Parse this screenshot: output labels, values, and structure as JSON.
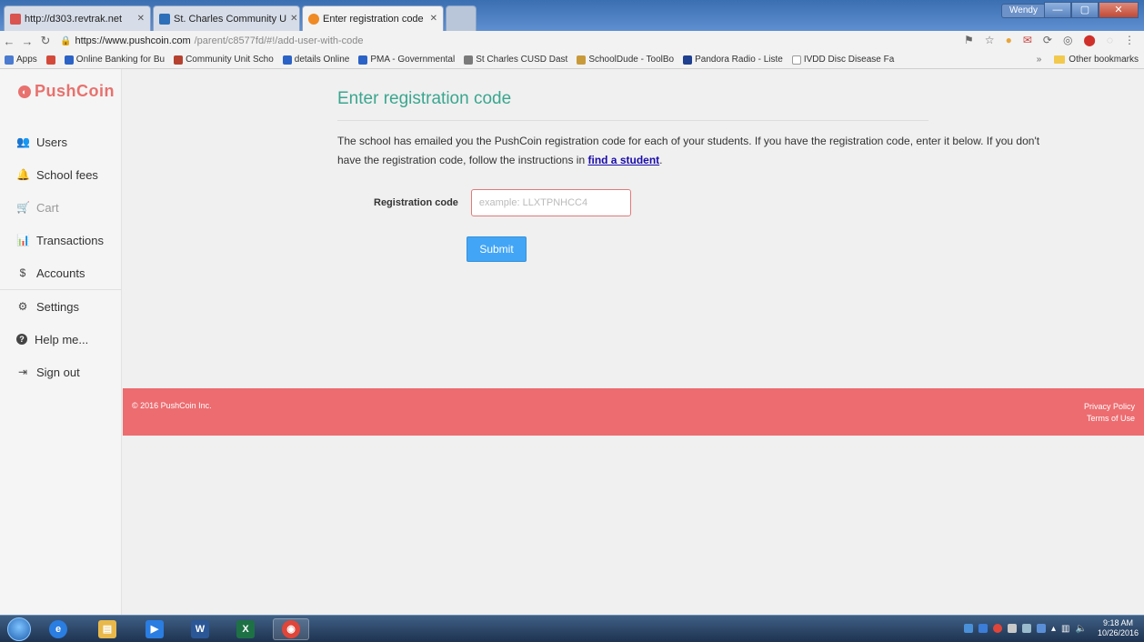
{
  "browser": {
    "tabs": [
      {
        "label": "http://d303.revtrak.net",
        "favicon_color": "#d9534f"
      },
      {
        "label": "St. Charles Community U",
        "favicon_color": "#2d6fb8"
      },
      {
        "label": "Enter registration code",
        "favicon_color": "#f08a24"
      }
    ],
    "user_button": "Wendy",
    "url_host": "https://www.pushcoin.com",
    "url_path": "/parent/c8577fd/#!/add-user-with-code",
    "bookmarks": [
      {
        "label": "Apps",
        "color": "#4a7bd0"
      },
      {
        "label": "",
        "color": "#d44a3a"
      },
      {
        "label": "Online Banking for Bu",
        "color": "#2b62c6"
      },
      {
        "label": "Community Unit Scho",
        "color": "#b5412f"
      },
      {
        "label": "details Online",
        "color": "#2b62c6"
      },
      {
        "label": "PMA - Governmental",
        "color": "#2b62c6"
      },
      {
        "label": "St Charles CUSD Dast",
        "color": "#7a7a7a"
      },
      {
        "label": "SchoolDude - ToolBo",
        "color": "#c99a3a"
      },
      {
        "label": "Pandora Radio - Liste",
        "color": "#1f3f8f"
      },
      {
        "label": "IVDD Disc Disease Fa",
        "color": "#9a9a9a"
      }
    ],
    "other_bookmarks": "Other bookmarks"
  },
  "app": {
    "logo": "PushCoin",
    "menu": [
      {
        "label": "Users",
        "icon": "users-icon",
        "glyph": "👥",
        "disabled": false
      },
      {
        "label": "School fees",
        "icon": "bell-icon",
        "glyph": "🔔",
        "disabled": false
      },
      {
        "label": "Cart",
        "icon": "cart-icon",
        "glyph": "🛒",
        "disabled": true
      },
      {
        "label": "Transactions",
        "icon": "bar-chart-icon",
        "glyph": "📊",
        "disabled": false
      },
      {
        "label": "Accounts",
        "icon": "dollar-icon",
        "glyph": "$",
        "disabled": false
      },
      {
        "label": "Settings",
        "icon": "gears-icon",
        "glyph": "⚙",
        "disabled": false
      },
      {
        "label": "Help me...",
        "icon": "question-icon",
        "glyph": "?",
        "disabled": false
      },
      {
        "label": "Sign out",
        "icon": "sign-out-icon",
        "glyph": "⇥",
        "disabled": false
      }
    ],
    "page": {
      "title": "Enter registration code",
      "description_1": "The school has emailed you the PushCoin registration code for each of your students. If you have the registration code, enter it below. If you don't have the registration code, follow the instructions in ",
      "description_link": "find a student",
      "description_end": ".",
      "field_label": "Registration code",
      "field_placeholder": "example: LLXTPNHCC4",
      "field_value": "",
      "submit": "Submit"
    },
    "footer": {
      "copyright": "© 2016 PushCoin Inc.",
      "privacy": "Privacy Policy",
      "terms": "Terms of Use"
    }
  },
  "taskbar": {
    "apps": [
      {
        "name": "ie-icon",
        "glyph": "e",
        "color": "#2a7de1"
      },
      {
        "name": "explorer-icon",
        "glyph": "▤",
        "color": "#e8b84a"
      },
      {
        "name": "media-player-icon",
        "glyph": "▶",
        "color": "#2a7de1"
      },
      {
        "name": "word-icon",
        "glyph": "W",
        "color": "#2b5797"
      },
      {
        "name": "excel-icon",
        "glyph": "X",
        "color": "#1e7145"
      },
      {
        "name": "chrome-icon",
        "glyph": "◉",
        "color": "#e0453a"
      }
    ],
    "time": "9:18 AM",
    "date": "10/26/2016"
  }
}
